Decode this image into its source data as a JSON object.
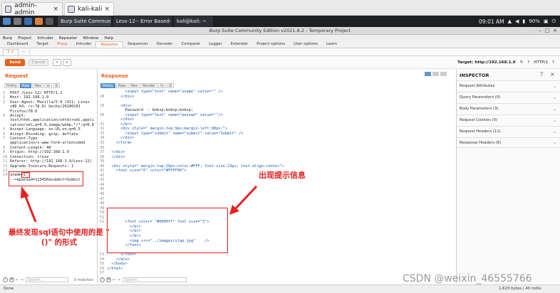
{
  "vm_tabs": [
    {
      "label": "admin-admin",
      "active": false
    },
    {
      "label": "kali-kali",
      "active": true
    }
  ],
  "taskbar": {
    "tasks": [
      "Burp Suite Community E...",
      "Less-12-- Error Based- D...",
      "kali@kali: ~"
    ],
    "time": "09:01 AM",
    "battery": "90%"
  },
  "window_title": "Burp Suite Community Edition v2021.8.2 - Temporary Project",
  "menu": [
    "Burp",
    "Project",
    "Intruder",
    "Repeater",
    "Window",
    "Help"
  ],
  "top_tabs": [
    "Dashboard",
    "Target",
    "Proxy",
    "Intruder",
    "Repeater",
    "Sequencer",
    "Decoder",
    "Comparer",
    "Logger",
    "Extender",
    "Project options",
    "User options",
    "Learn"
  ],
  "repeater_tabs": [
    "1 ×",
    "..."
  ],
  "toolbar": {
    "send": "Send",
    "cancel": "Cancel",
    "back": "<",
    "forward": ">",
    "target": "Target: http://192.168.1.9",
    "http": "HTTP/1"
  },
  "request": {
    "title": "Request",
    "formats": [
      "Pretty",
      "Raw",
      "Hex",
      "\\n",
      "☰"
    ],
    "active_format": "Raw",
    "lines": [
      {
        "n": "1",
        "t": "POST /Less-12/ HTTP/1.1"
      },
      {
        "n": "2",
        "t": "Host: 192.168.1.9"
      },
      {
        "n": "3",
        "t": "User-Agent: Mozilla/5.0 (X11; Linux"
      },
      {
        "n": "",
        "t": "x86_64; rv:78.0) Gecko/20100101"
      },
      {
        "n": "",
        "t": "Firefox/78.0"
      },
      {
        "n": "4",
        "t": "Accept:"
      },
      {
        "n": "",
        "t": "text/html,application/xhtml+xml,appli"
      },
      {
        "n": "",
        "t": "cation/xml;q=0.9,image/webp,*/*;q=0.8"
      },
      {
        "n": "5",
        "t": "Accept-Language: en-US,en;q=0.5"
      },
      {
        "n": "6",
        "t": "Accept-Encoding: gzip, deflate"
      },
      {
        "n": "7",
        "t": "Content-Type:"
      },
      {
        "n": "",
        "t": "application/x-www-form-urlencoded"
      },
      {
        "n": "8",
        "t": "Content-Length: 40"
      },
      {
        "n": "9",
        "t": "Origin: http://192.168.1.9"
      },
      {
        "n": "10",
        "t": "Connection: close"
      },
      {
        "n": "11",
        "t": "Referer: http://192.168.1.9/Less-12/"
      },
      {
        "n": "12",
        "t": "Upgrade-Insecure-Requests: 1"
      },
      {
        "n": "13",
        "t": ""
      },
      {
        "n": "14",
        "t": "uname=1\")"
      },
      {
        "n": "",
        "t": "--+&passwd=123456&submit=Submit"
      }
    ],
    "search_placeholder": "Search...",
    "matches": "0 matches"
  },
  "response": {
    "title": "Response",
    "formats": [
      "Pretty",
      "Raw",
      "Hex",
      "Render",
      "\\n",
      "☰"
    ],
    "active_format": "Pretty",
    "lines": [
      {
        "n": "",
        "t": "        <input type=\"text\" name=\"uname\" value=\"\" />"
      },
      {
        "n": "28",
        "t": "      </div>"
      },
      {
        "n": "",
        "t": ""
      },
      {
        "n": "29",
        "t": "      <div>"
      },
      {
        "n": "",
        "t": "        Password  : &nbsp;&nbsp;&nbsp;"
      },
      {
        "n": "30",
        "t": "        <input type=\"text\" name=\"passwd\" value=\"\"/>"
      },
      {
        "n": "",
        "t": "      </div>"
      },
      {
        "n": "31",
        "t": "      </br>"
      },
      {
        "n": "32",
        "t": "      <div style=\" margin-top:9px;margin-left:90px;\">"
      },
      {
        "n": "33",
        "t": "        <input type=\"submit\" name=\"submit\" value=\"Submit\" />"
      },
      {
        "n": "34",
        "t": "      </div>"
      },
      {
        "n": "35",
        "t": "    </form>"
      },
      {
        "n": "36",
        "t": ""
      },
      {
        "n": "37",
        "t": "  </div>"
      },
      {
        "n": "38",
        "t": "  </div>"
      },
      {
        "n": "39",
        "t": ""
      },
      {
        "n": "40",
        "t": "  <div style=\" margin-top:10px;color:#FFF; font-size:23px; text-align:center\">"
      },
      {
        "n": "41",
        "t": "    <font size=\"6\" color=\"#FFFF00\">"
      },
      {
        "n": "42",
        "t": ""
      },
      {
        "n": "43",
        "t": ""
      },
      {
        "n": "44",
        "t": ""
      },
      {
        "n": "45",
        "t": ""
      },
      {
        "n": "46",
        "t": ""
      },
      {
        "n": "47",
        "t": ""
      },
      {
        "n": "48",
        "t": ""
      },
      {
        "n": "49",
        "t": ""
      },
      {
        "n": "50",
        "t": ""
      },
      {
        "n": "51",
        "t": ""
      },
      {
        "n": "52",
        "t": "        <font color= \"#0000ff\" font size=\"3\">"
      },
      {
        "n": "",
        "t": "          </br>"
      },
      {
        "n": "",
        "t": "          </br>"
      },
      {
        "n": "",
        "t": "          </br>"
      },
      {
        "n": "",
        "t": "          <img src=\"../images/slap.jpg\"    />"
      },
      {
        "n": "",
        "t": "        </font>"
      },
      {
        "n": "",
        "t": ""
      },
      {
        "n": "53",
        "t": "      </font>"
      },
      {
        "n": "54",
        "t": "    </div>"
      },
      {
        "n": "55",
        "t": "  </body>"
      },
      {
        "n": "56",
        "t": "</html>"
      },
      {
        "n": "57",
        "t": ""
      }
    ],
    "search_placeholder": "Search...",
    "matches": "0 matches"
  },
  "inspector": {
    "title": "INSPECTOR",
    "sections": [
      "Request Attributes",
      "Query Parameters (0)",
      "Body Parameters (3)",
      "Request Cookies (0)",
      "Request Headers (11)",
      "Response Headers (6)"
    ]
  },
  "status": {
    "left": "Done",
    "right": "1,623 bytes | 40 millis"
  },
  "annotations": {
    "left": "最终发现sql语句中使用的是 \"()\" 的形式",
    "right": "出现提示信息"
  },
  "watermark": "CSDN @weixin_46555766",
  "colors": {
    "accent": "#e8601c",
    "annotation": "#e62020"
  }
}
